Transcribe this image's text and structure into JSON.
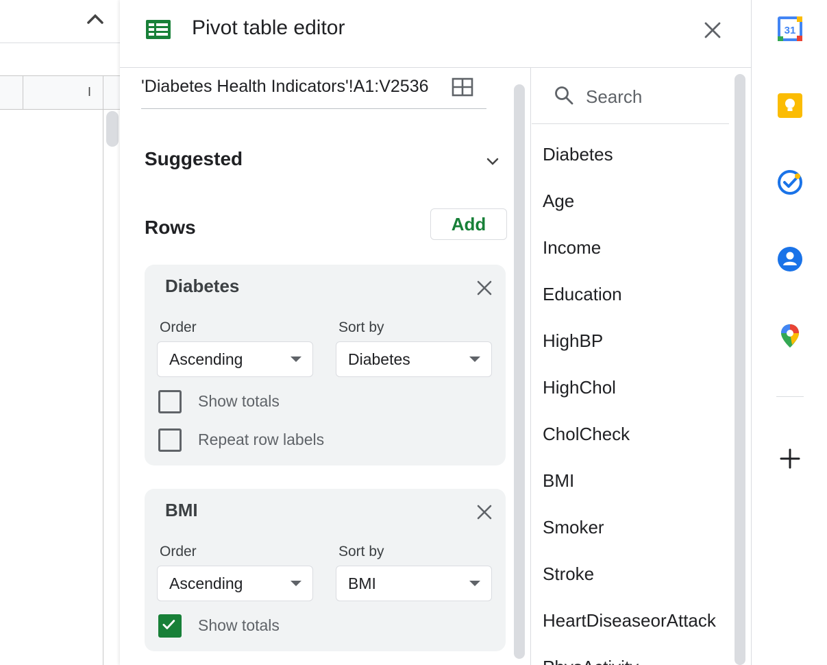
{
  "sheet": {
    "column_letter": "I"
  },
  "editor": {
    "title": "Pivot table editor",
    "range": "'Diabetes Health Indicators'!A1:V2536",
    "suggested_label": "Suggested",
    "rows_label": "Rows",
    "add_label": "Add",
    "cards": [
      {
        "title": "Diabetes",
        "order_label": "Order",
        "order_value": "Ascending",
        "sort_label": "Sort by",
        "sort_value": "Diabetes",
        "show_totals_label": "Show totals",
        "show_totals_checked": false,
        "repeat_labels_label": "Repeat row labels",
        "repeat_labels_checked": false
      },
      {
        "title": "BMI",
        "order_label": "Order",
        "order_value": "Ascending",
        "sort_label": "Sort by",
        "sort_value": "BMI",
        "show_totals_label": "Show totals",
        "show_totals_checked": true
      }
    ]
  },
  "fields": {
    "search_placeholder": "Search",
    "items": [
      "Diabetes",
      "Age",
      "Income",
      "Education",
      "HighBP",
      "HighChol",
      "CholCheck",
      "BMI",
      "Smoker",
      "Stroke",
      "HeartDiseaseorAttack",
      "PhysActivity"
    ]
  },
  "sidebar": {
    "calendar_day": "31",
    "icons": [
      "calendar-icon",
      "keep-icon",
      "tasks-icon",
      "contacts-icon",
      "maps-icon",
      "add-icon"
    ]
  },
  "colors": {
    "accent_green": "#188038",
    "keep_yellow": "#fbbc04",
    "blue": "#1a73e8"
  }
}
